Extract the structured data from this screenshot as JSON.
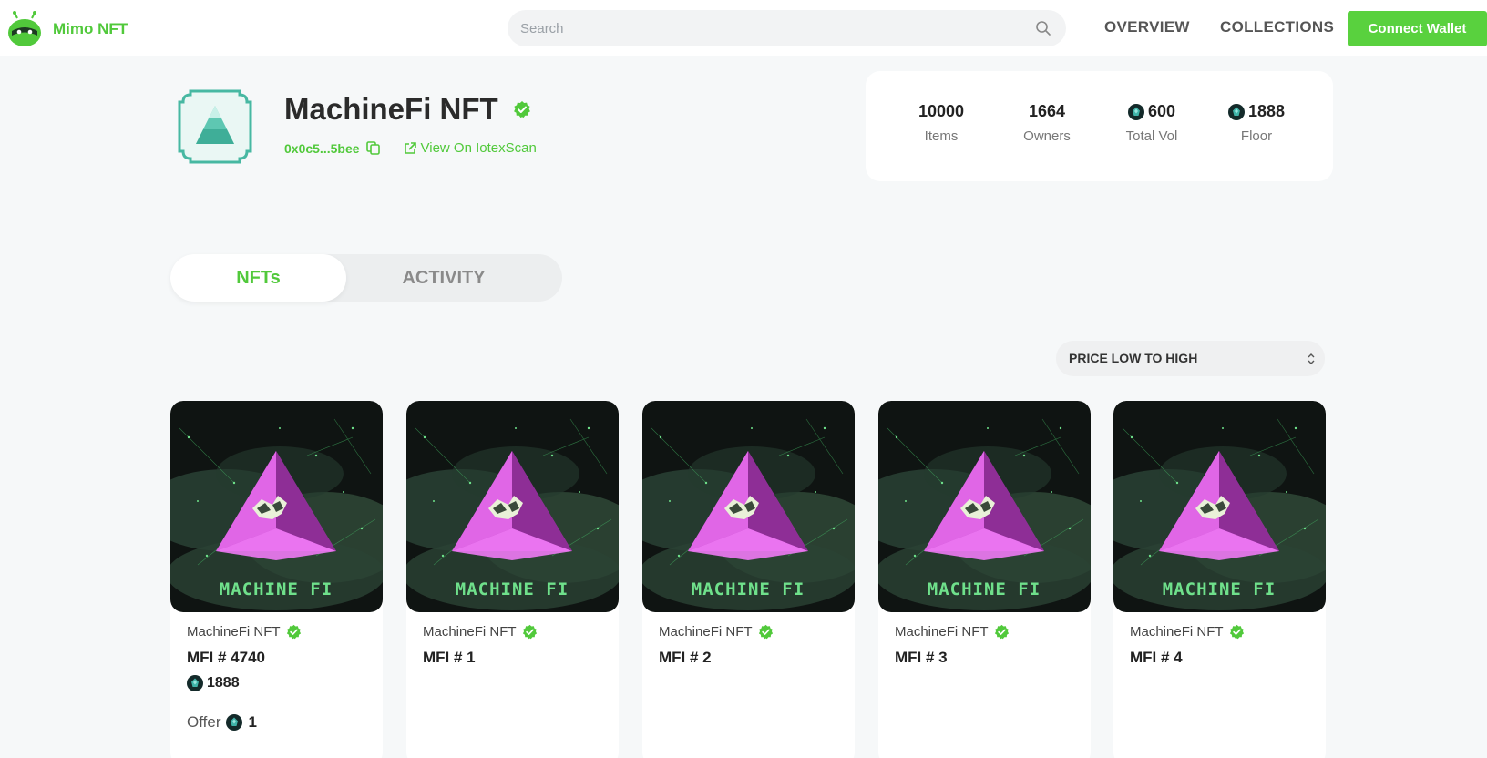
{
  "brand": {
    "name": "Mimo NFT",
    "logo_icon": "mimo-robot-icon",
    "accent": "#51c93b"
  },
  "search": {
    "placeholder": "Search",
    "value": ""
  },
  "nav": {
    "overview": "OVERVIEW",
    "collections": "COLLECTIONS",
    "connect": "Connect Wallet"
  },
  "collection": {
    "title": "MachineFi NFT",
    "address": "0x0c5...5bee",
    "scan_link": "View On IotexScan",
    "stats": [
      {
        "value": "10000",
        "label": "Items",
        "coin": false
      },
      {
        "value": "1664",
        "label": "Owners",
        "coin": false
      },
      {
        "value": "600",
        "label": "Total Vol",
        "coin": true
      },
      {
        "value": "1888",
        "label": "Floor",
        "coin": true
      }
    ]
  },
  "tabs": {
    "nfts": "NFTs",
    "activity": "ACTIVITY",
    "active": "NFTs"
  },
  "sort": {
    "selected": "PRICE LOW TO HIGH"
  },
  "cards": [
    {
      "collection": "MachineFi NFT",
      "token": "MFI # 4740",
      "price": "1888",
      "offer_label": "Offer",
      "offer_value": "1",
      "art_text": "MACHINE FI"
    },
    {
      "collection": "MachineFi NFT",
      "token": "MFI # 1",
      "art_text": "MACHINE FI"
    },
    {
      "collection": "MachineFi NFT",
      "token": "MFI # 2",
      "art_text": "MACHINE FI"
    },
    {
      "collection": "MachineFi NFT",
      "token": "MFI # 3",
      "art_text": "MACHINE FI"
    },
    {
      "collection": "MachineFi NFT",
      "token": "MFI # 4",
      "art_text": "MACHINE FI"
    }
  ],
  "colors": {
    "green": "#51c93b",
    "button": "#59d13e",
    "background": "#f6f8f9",
    "art_bg": "#0f1412",
    "art_magenta": "#d34bd8"
  }
}
